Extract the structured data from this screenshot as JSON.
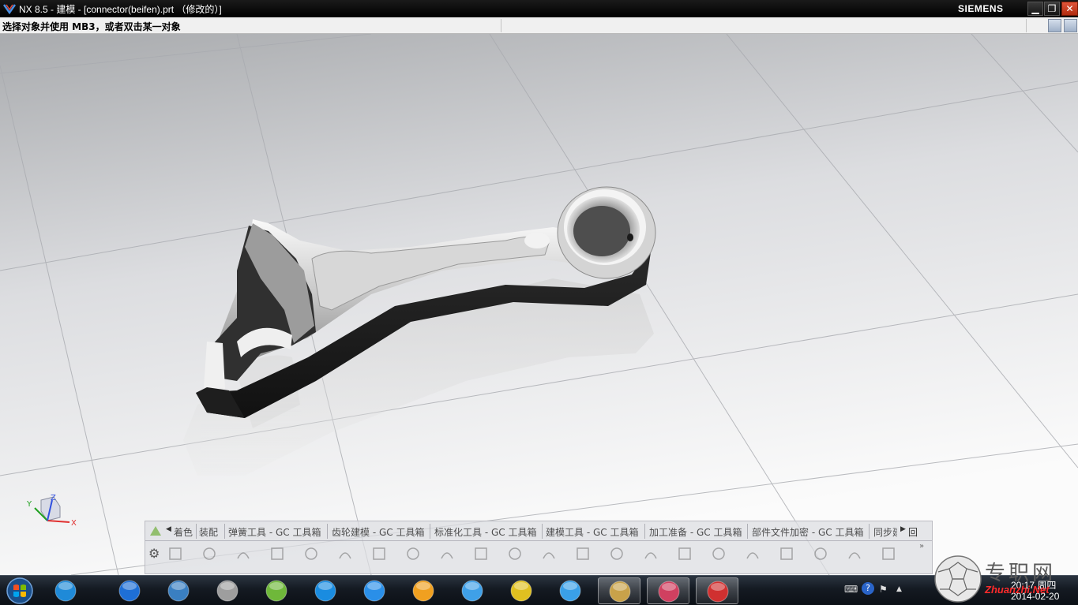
{
  "window": {
    "title": "NX 8.5 - 建模 - [connector(beifen).prt （修改的）]",
    "brand": "SIEMENS",
    "minimize": "▁",
    "maximize": "❐",
    "close": "✕"
  },
  "cue": {
    "message": "选择对象并使用 MB3，或者双击某一对象"
  },
  "viewport": {
    "background_top": "#a9abae",
    "background_bottom": "#fbfbfb",
    "model_name": "connector(beifen).prt",
    "triad": {
      "x_label": "X",
      "y_label": "Y",
      "z_label": "Z"
    }
  },
  "ribbon": {
    "scroll_left": "◀",
    "scroll_right": "▶",
    "tabs": [
      "着色",
      "装配",
      "弹簧工具 - GC 工具箱",
      "齿轮建模 - GC 工具箱",
      "标准化工具 - GC 工具箱",
      "建模工具 - GC 工具箱",
      "加工准备 - GC 工具箱",
      "部件文件加密 - GC 工具箱",
      "同步建模"
    ],
    "tab_end": "回",
    "gear": "⚙",
    "more": "»",
    "tools": [
      "sketch-icon",
      "datum-icon",
      "spline-icon",
      "line-icon",
      "arc-icon",
      "circle-icon",
      "fillet-icon",
      "rectangle-icon",
      "polyline-icon",
      "point-icon",
      "profile-icon",
      "trim-icon",
      "offset-icon",
      "pattern-icon",
      "mirror-icon",
      "extrude-icon",
      "revolve-icon",
      "block-icon",
      "cylinder-icon",
      "cone-icon",
      "sphere-icon",
      "hole-icon"
    ]
  },
  "taskbar": {
    "items": [
      {
        "name": "windows-explorer-icon",
        "color": "#1f8ad8"
      },
      {
        "name": "internet-explorer-icon",
        "color": "#1e6fd6"
      },
      {
        "name": "search-tool-icon",
        "color": "#3a7fc1"
      },
      {
        "name": "chrome-icon",
        "color": "#9e9e9e"
      },
      {
        "name": "media-player-icon",
        "color": "#6fb83a"
      },
      {
        "name": "kugou-icon",
        "color": "#1a8ce0"
      },
      {
        "name": "play-icon",
        "color": "#2a8fe8"
      },
      {
        "name": "download-tool-icon",
        "color": "#f0a020"
      },
      {
        "name": "plane-icon",
        "color": "#3fa0e8"
      },
      {
        "name": "music-icon",
        "color": "#e0c020"
      },
      {
        "name": "cloud-icon",
        "color": "#3aa0e8"
      },
      {
        "name": "league-client-icon",
        "color": "#c8a24a"
      },
      {
        "name": "spectrum-app-icon",
        "color": "#d04060"
      },
      {
        "name": "nx-app-icon",
        "color": "#d03030"
      }
    ],
    "tray": {
      "keyboard": "⌨",
      "help": "?",
      "flag": "⚑",
      "arrow": "▲",
      "time": "20:17 周四",
      "date": "2014-02-20"
    }
  },
  "watermark": {
    "site_name": "专职网",
    "site_url": "Zhuanzhi.Net"
  }
}
